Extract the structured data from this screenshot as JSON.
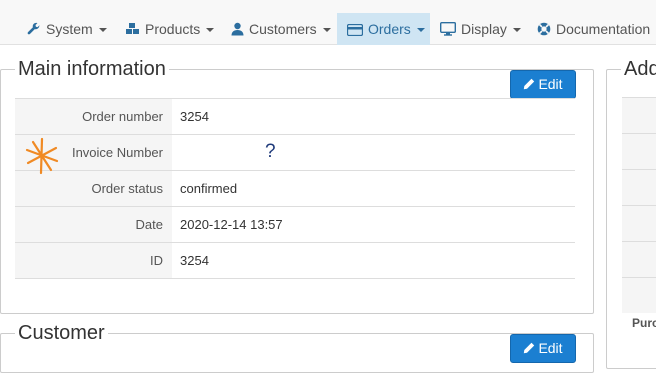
{
  "nav": {
    "items": [
      {
        "label": "System",
        "icon": "wrench-icon"
      },
      {
        "label": "Products",
        "icon": "cubes-icon"
      },
      {
        "label": "Customers",
        "icon": "user-icon"
      },
      {
        "label": "Orders",
        "icon": "credit-card-icon",
        "active": true
      },
      {
        "label": "Display",
        "icon": "monitor-icon"
      },
      {
        "label": "Documentation",
        "icon": "lifebuoy-icon"
      }
    ]
  },
  "main_info": {
    "title": "Main information",
    "edit_label": "Edit",
    "rows": [
      {
        "label": "Order number",
        "value": "3254"
      },
      {
        "label": "Invoice Number",
        "value": "",
        "annotation": "?"
      },
      {
        "label": "Order status",
        "value": "confirmed"
      },
      {
        "label": "Date",
        "value": "2020-12-14 13:57"
      },
      {
        "label": "ID",
        "value": "3254"
      }
    ]
  },
  "customer": {
    "title": "Customer",
    "edit_label": "Edit"
  },
  "right_panel": {
    "title": "Add",
    "row_label": "Purc"
  },
  "colors": {
    "accent": "#1b7fd1",
    "nav_active_bg": "#cfe5f3",
    "annotation_star": "#f08a24"
  }
}
